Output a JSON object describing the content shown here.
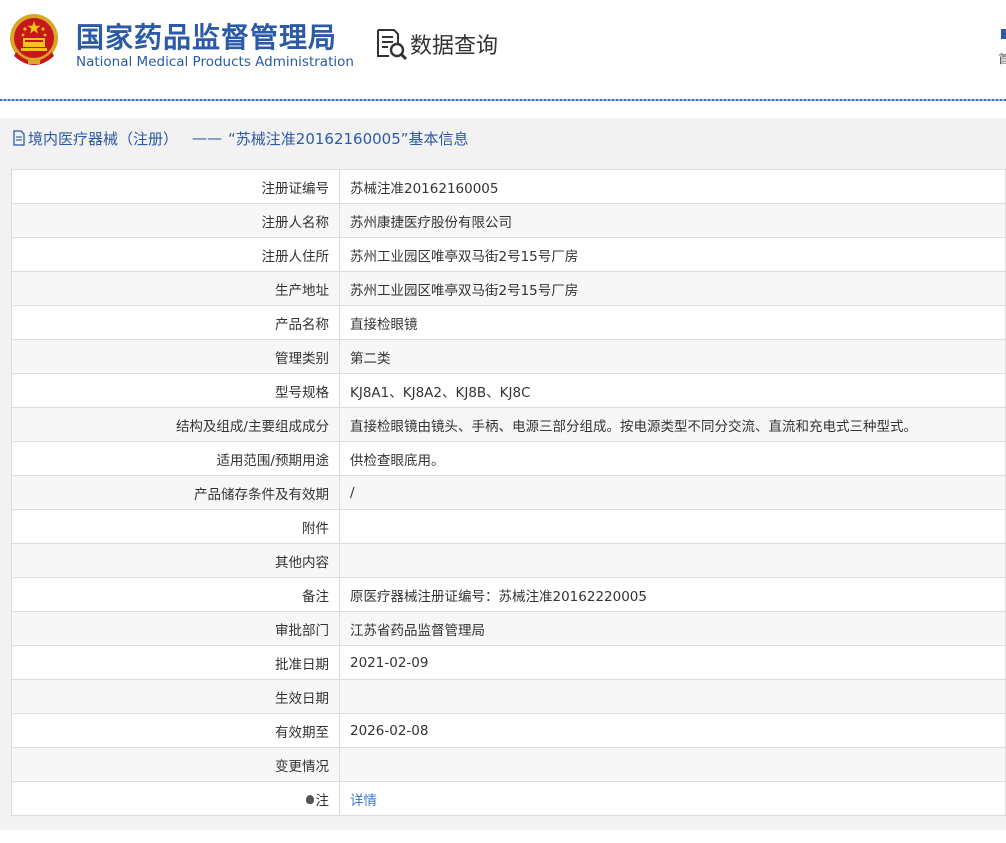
{
  "header": {
    "title_cn": "国家药品监督管理局",
    "title_en": "National Medical Products Administration",
    "query_label": "数据查询",
    "corner_char": "首"
  },
  "breadcrumb": {
    "section": "境内医疗器械（注册）",
    "separator": "——",
    "record_title": "“苏械注准20162160005”基本信息"
  },
  "rows": [
    {
      "label": "注册证编号",
      "value": "苏械注准20162160005"
    },
    {
      "label": "注册人名称",
      "value": "苏州康捷医疗股份有限公司"
    },
    {
      "label": "注册人住所",
      "value": "苏州工业园区唯亭双马街2号15号厂房"
    },
    {
      "label": "生产地址",
      "value": "苏州工业园区唯亭双马街2号15号厂房"
    },
    {
      "label": "产品名称",
      "value": "直接检眼镜"
    },
    {
      "label": "管理类别",
      "value": "第二类"
    },
    {
      "label": "型号规格",
      "value": "KJ8A1、KJ8A2、KJ8B、KJ8C"
    },
    {
      "label": "结构及组成/主要组成成分",
      "value": "直接检眼镜由镜头、手柄、电源三部分组成。按电源类型不同分交流、直流和充电式三种型式。"
    },
    {
      "label": "适用范围/预期用途",
      "value": "供检查眼底用。"
    },
    {
      "label": "产品储存条件及有效期",
      "value": "/"
    },
    {
      "label": "附件",
      "value": ""
    },
    {
      "label": "其他内容",
      "value": ""
    },
    {
      "label": "备注",
      "value": "原医疗器械注册证编号：苏械注准20162220005"
    },
    {
      "label": "审批部门",
      "value": "江苏省药品监督管理局"
    },
    {
      "label": "批准日期",
      "value": "2021-02-09"
    },
    {
      "label": "生效日期",
      "value": ""
    },
    {
      "label": "有效期至",
      "value": "2026-02-08"
    },
    {
      "label": "变更情况",
      "value": ""
    },
    {
      "label": "注",
      "value": "详情"
    }
  ],
  "colors": {
    "brand_blue": "#2b5aa6",
    "link_blue": "#3a7bd5"
  }
}
